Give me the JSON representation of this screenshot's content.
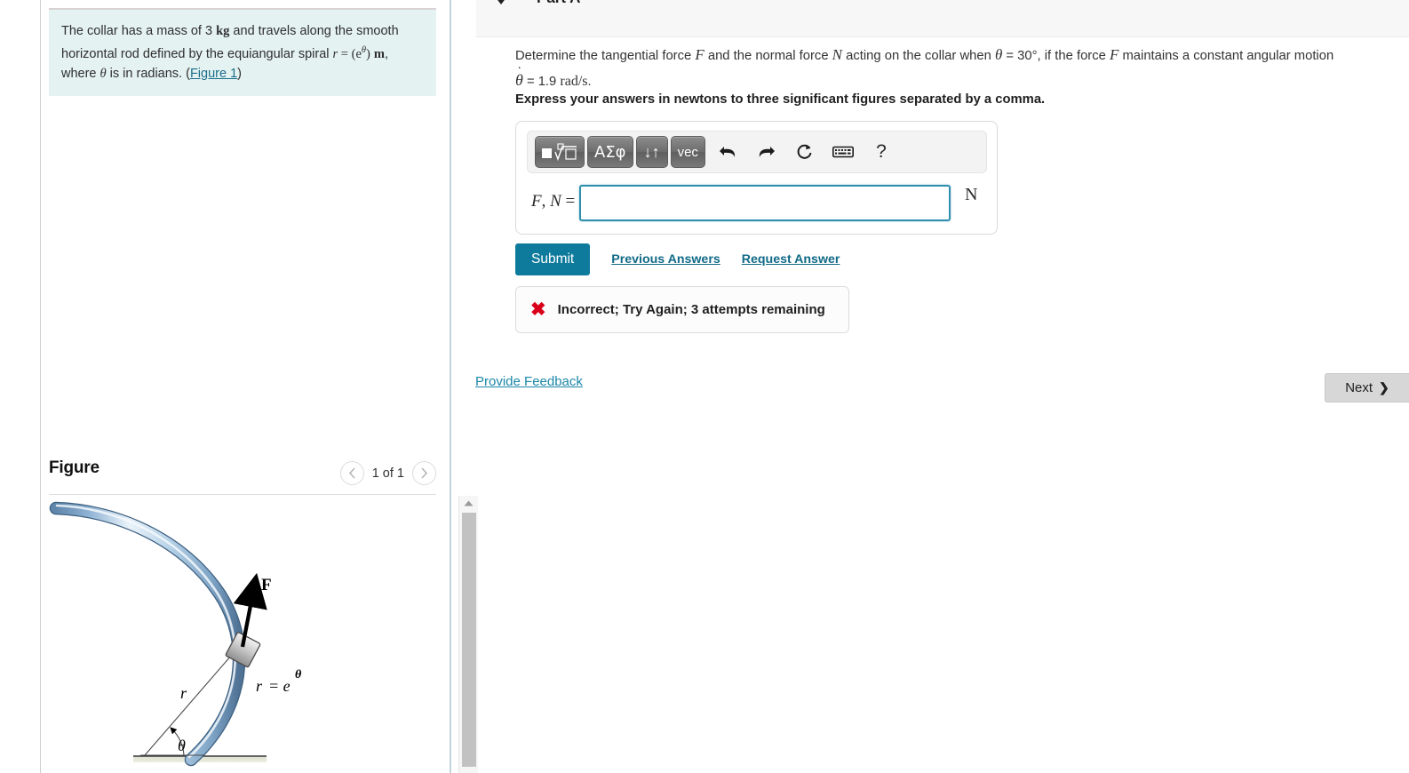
{
  "problem": {
    "text_part1": "The collar has a mass of 3 ",
    "mass_unit": "kg",
    "text_part2": " and travels along the smooth horizontal rod defined by the equiangular spiral ",
    "spiral_r": "r",
    "spiral_eq": " = ",
    "spiral_expr": "(e",
    "spiral_exp": "θ",
    "spiral_close": ")",
    "spiral_unit": "m",
    "text_part3": ", where ",
    "theta_sym": "θ",
    "text_part4": " is in radians. (",
    "figure_link": "Figure 1",
    "text_part5": ")"
  },
  "figure": {
    "title": "Figure",
    "counter": "1 of 1",
    "prev_icon": "chevron-left-icon",
    "next_icon": "chevron-right-icon",
    "labels": {
      "force": "F",
      "radius": "r",
      "angle": "θ",
      "equation_r": "r",
      "equation_eq": "= e",
      "equation_exp": "θ"
    }
  },
  "part": {
    "title": "Part A",
    "caret_icon": "caret-down-icon"
  },
  "question": {
    "line1_a": "Determine the tangential force ",
    "force_F": "F",
    "line1_b": " and the normal force ",
    "force_N": "N",
    "line1_c": " acting on the collar when ",
    "theta": "θ",
    "theta_eq": " = 30",
    "degree": "°",
    "line1_d": ", if the force ",
    "force_F2": "F",
    "line1_e": " maintains a constant angular motion",
    "theta_dot": "θ",
    "theta_dot_eq": " = 1.9 ",
    "rad_unit": "rad/s",
    "period": ".",
    "express": "Express your answers in newtons to three significant figures separated by a comma."
  },
  "answer": {
    "toolbar": {
      "template_label": "■",
      "root_label": "√",
      "greek_label": "ΑΣφ",
      "subsup_label": "↓↑",
      "vec_label": "vec",
      "undo_icon": "undo-arrow-icon",
      "redo_icon": "redo-arrow-icon",
      "reset_icon": "reset-circle-icon",
      "keyboard_icon": "keyboard-icon",
      "help_label": "?"
    },
    "label_F": "F",
    "label_comma": ", ",
    "label_N": "N",
    "label_eq": " =",
    "value": "",
    "placeholder": "",
    "unit": "N"
  },
  "actions": {
    "submit": "Submit",
    "previous_answers": "Previous Answers",
    "request_answer": "Request Answer"
  },
  "feedback": {
    "x_icon": "✖",
    "message": "Incorrect; Try Again; 3 attempts remaining"
  },
  "footer": {
    "provide_feedback": "Provide Feedback",
    "next": "Next",
    "next_chevron": "❯"
  },
  "colors": {
    "problem_bg": "#e4f2f1",
    "submit_bg": "#0f7b9c",
    "link": "#106a87",
    "error": "#d9001b",
    "input_border": "#2f8fae",
    "rod_blue": "#7fa8cc"
  }
}
